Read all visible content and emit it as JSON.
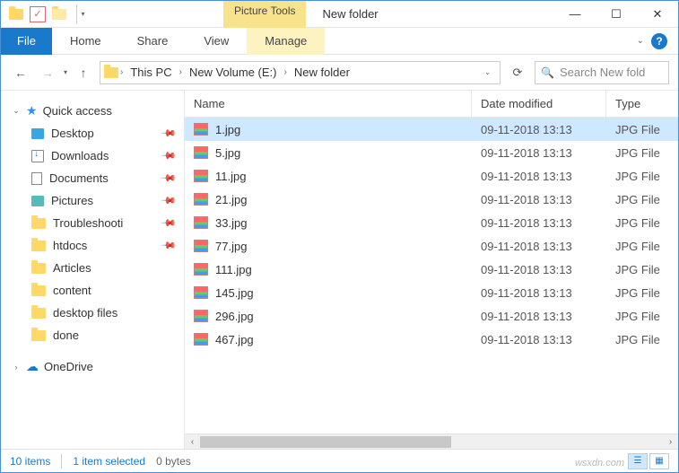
{
  "title": "New folder",
  "context_tab_group": "Picture Tools",
  "ribbon": {
    "file": "File",
    "tabs": [
      "Home",
      "Share",
      "View"
    ],
    "context_tab": "Manage"
  },
  "breadcrumb": {
    "items": [
      "This PC",
      "New Volume (E:)",
      "New folder"
    ]
  },
  "search": {
    "placeholder": "Search New fold"
  },
  "nav": {
    "quick_access": "Quick access",
    "items": [
      {
        "label": "Desktop",
        "pinned": true,
        "icon": "desktop"
      },
      {
        "label": "Downloads",
        "pinned": true,
        "icon": "downloads"
      },
      {
        "label": "Documents",
        "pinned": true,
        "icon": "docs"
      },
      {
        "label": "Pictures",
        "pinned": true,
        "icon": "pics"
      },
      {
        "label": "Troubleshooti",
        "pinned": true,
        "icon": "folder"
      },
      {
        "label": "htdocs",
        "pinned": true,
        "icon": "folder"
      },
      {
        "label": "Articles",
        "pinned": false,
        "icon": "folder"
      },
      {
        "label": "content",
        "pinned": false,
        "icon": "folder"
      },
      {
        "label": "desktop files",
        "pinned": false,
        "icon": "folder"
      },
      {
        "label": "done",
        "pinned": false,
        "icon": "folder"
      }
    ],
    "onedrive": "OneDrive"
  },
  "columns": {
    "name": "Name",
    "date": "Date modified",
    "type": "Type"
  },
  "files": [
    {
      "name": "1.jpg",
      "date": "09-11-2018 13:13",
      "type": "JPG File",
      "selected": true
    },
    {
      "name": "5.jpg",
      "date": "09-11-2018 13:13",
      "type": "JPG File",
      "selected": false
    },
    {
      "name": "11.jpg",
      "date": "09-11-2018 13:13",
      "type": "JPG File",
      "selected": false
    },
    {
      "name": "21.jpg",
      "date": "09-11-2018 13:13",
      "type": "JPG File",
      "selected": false
    },
    {
      "name": "33.jpg",
      "date": "09-11-2018 13:13",
      "type": "JPG File",
      "selected": false
    },
    {
      "name": "77.jpg",
      "date": "09-11-2018 13:13",
      "type": "JPG File",
      "selected": false
    },
    {
      "name": "111.jpg",
      "date": "09-11-2018 13:13",
      "type": "JPG File",
      "selected": false
    },
    {
      "name": "145.jpg",
      "date": "09-11-2018 13:13",
      "type": "JPG File",
      "selected": false
    },
    {
      "name": "296.jpg",
      "date": "09-11-2018 13:13",
      "type": "JPG File",
      "selected": false
    },
    {
      "name": "467.jpg",
      "date": "09-11-2018 13:13",
      "type": "JPG File",
      "selected": false
    }
  ],
  "status": {
    "count": "10 items",
    "selection": "1 item selected",
    "size": "0 bytes"
  },
  "watermark": "wsxdn.com"
}
